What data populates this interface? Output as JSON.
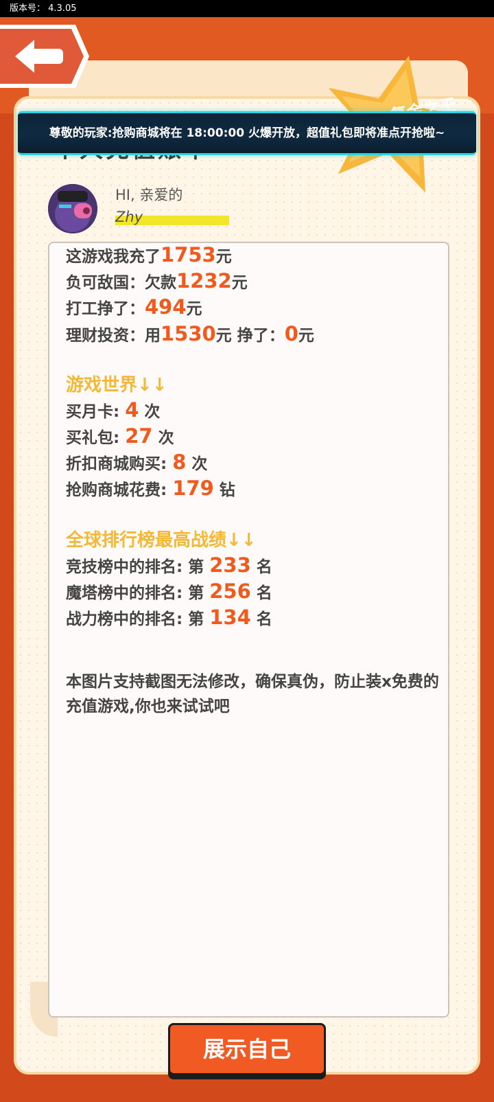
{
  "version": "版本号：  4.3.05",
  "notice": "尊敬的玩家:抢购商城将在 18:00:00 火爆开放，超值礼包即将准点开抢啦~",
  "title_behind": "个人充值账单",
  "stamp_text": "氪金之王",
  "profile": {
    "greeting": "HI, 亲爱的",
    "username": "Zhy"
  },
  "summary": [
    {
      "label": "这游戏我充了",
      "value": "1753",
      "unit": "元"
    },
    {
      "label": "负可敌国：欠款",
      "value": "1232",
      "unit": "元"
    },
    {
      "label": "打工挣了：",
      "value": "494",
      "unit": "元"
    },
    {
      "label": "理财投资：用",
      "value": "1530",
      "unit": "元  挣了：",
      "value2": "0",
      "unit2": "元"
    }
  ],
  "game_world": {
    "heading": "游戏世界↓↓",
    "items": [
      {
        "label": "买月卡:",
        "value": "4",
        "unit": "次"
      },
      {
        "label": "买礼包:",
        "value": "27",
        "unit": "次"
      },
      {
        "label": "折扣商城购买:",
        "value": "8",
        "unit": "次"
      },
      {
        "label": "抢购商城花费:",
        "value": "179",
        "unit": "钻"
      }
    ]
  },
  "ranking": {
    "heading": "全球排行榜最高战绩↓↓",
    "items": [
      {
        "label": "竞技榜中的排名: 第",
        "value": "233",
        "unit": "名"
      },
      {
        "label": "魔塔榜中的排名: 第",
        "value": "256",
        "unit": "名"
      },
      {
        "label": "战力榜中的排名: 第",
        "value": "134",
        "unit": "名"
      }
    ]
  },
  "note": "本图片支持截图无法修改，确保真伪，防止装x免费的充值游戏,你也来试试吧",
  "button": "展示自己",
  "colors": {
    "accent": "#f05a1c",
    "heading": "#f3b835",
    "background": "#d24a1c"
  }
}
